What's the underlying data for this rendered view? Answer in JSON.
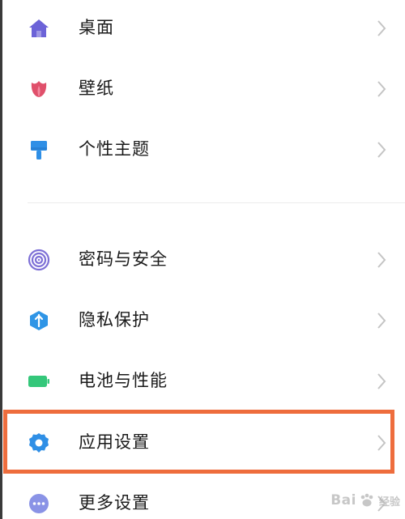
{
  "settings": {
    "items": [
      {
        "label": "桌面",
        "icon": "home-icon",
        "color": "#6c63d8"
      },
      {
        "label": "壁纸",
        "icon": "tulip-icon",
        "color": "#e0506b"
      },
      {
        "label": "个性主题",
        "icon": "paintbrush-icon",
        "color": "#2f8fe6"
      },
      {
        "label": "密码与安全",
        "icon": "fingerprint-icon",
        "color": "#7d6fd6"
      },
      {
        "label": "隐私保护",
        "icon": "shield-icon",
        "color": "#2f95e6"
      },
      {
        "label": "电池与性能",
        "icon": "battery-icon",
        "color": "#34c77a"
      },
      {
        "label": "应用设置",
        "icon": "gear-icon",
        "color": "#2f8fe6"
      },
      {
        "label": "更多设置",
        "icon": "more-icon",
        "color": "#8a93e6"
      }
    ],
    "highlighted_item": "应用设置"
  },
  "watermark": {
    "text": "Bai",
    "sub": "经验"
  },
  "colors": {
    "highlight_border": "#ee6d3d",
    "chevron": "#c4c4c4",
    "divider": "#ececec"
  }
}
